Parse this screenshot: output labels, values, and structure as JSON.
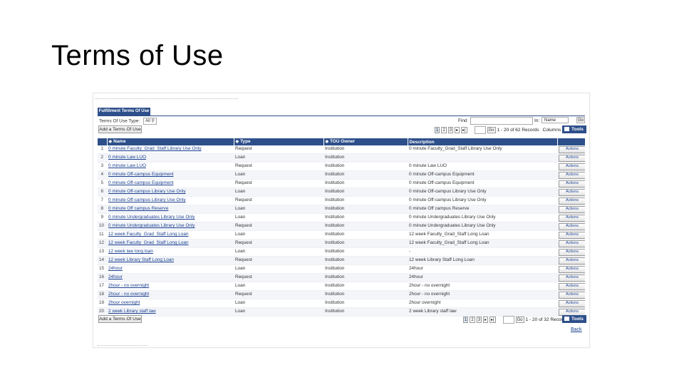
{
  "slide_title": "Terms of Use",
  "page_tab": "Fulfillment Terms Of Use",
  "filter": {
    "label": "Terms Of Use Type:",
    "value": "All"
  },
  "search": {
    "find_label": "Find",
    "find_value": "",
    "in_label": "In:",
    "in_value": "Name",
    "go_label": "Go"
  },
  "toolbar": {
    "add_label": "Add a Terms Of Use",
    "tools_label": "Tools",
    "columns_label": "Columns"
  },
  "pager": {
    "pages": [
      "1",
      "2",
      "3"
    ],
    "next": "▸",
    "last": "▸|",
    "go_label": "Go",
    "records": "1 - 20 of 62 Records",
    "records_bottom": "1 - 20 of 32 Records"
  },
  "columns": [
    "",
    "Name",
    "Type",
    "TOU Owner",
    "Description",
    ""
  ],
  "action_label": "Actions",
  "rows": [
    {
      "n": "1",
      "name": "0 minute Faculty_Grad_Staff Library Use Only",
      "type": "Request",
      "owner": "Institution",
      "desc": "0 minute Faculty_Grad_Staff Library Use Only"
    },
    {
      "n": "2",
      "name": "0 minute Law LUO",
      "type": "Loan",
      "owner": "Institution",
      "desc": ""
    },
    {
      "n": "3",
      "name": "0 minute Law LUO",
      "type": "Request",
      "owner": "Institution",
      "desc": "0 minute Law LUO"
    },
    {
      "n": "4",
      "name": "0 minute Off-campus Equipment",
      "type": "Loan",
      "owner": "Institution",
      "desc": "0 minute Off-campus Equipment"
    },
    {
      "n": "5",
      "name": "0 minute Off-campus Equipment",
      "type": "Request",
      "owner": "Institution",
      "desc": "0 minute Off-campus Equipment"
    },
    {
      "n": "6",
      "name": "0 minute Off-campus Library Use Only",
      "type": "Loan",
      "owner": "Institution",
      "desc": "0 minute Off-campus Library Use Only"
    },
    {
      "n": "7",
      "name": "0 minute Off-campus Library Use Only",
      "type": "Request",
      "owner": "Institution",
      "desc": "0 minute Off-campus Library Use Only"
    },
    {
      "n": "8",
      "name": "0 minute Off campus Reserve",
      "type": "Loan",
      "owner": "Institution",
      "desc": "0 minute Off campus Reserve"
    },
    {
      "n": "9",
      "name": "0 minute Undergraduates Library Use Only",
      "type": "Loan",
      "owner": "Institution",
      "desc": "0 minute Undergraduates Library Use Only"
    },
    {
      "n": "10",
      "name": "0 minute Undergraduates Library Use Only",
      "type": "Request",
      "owner": "Institution",
      "desc": "0 minute Undergraduates Library Use Only"
    },
    {
      "n": "11",
      "name": "12 week Faculty_Grad_Staff Long Loan",
      "type": "Loan",
      "owner": "Institution",
      "desc": "12 week Faculty_Grad_Staff Long Loan"
    },
    {
      "n": "12",
      "name": "12 week Faculty_Grad_Staff Long Loan",
      "type": "Request",
      "owner": "Institution",
      "desc": "12 week Faculty_Grad_Staff Long Loan"
    },
    {
      "n": "13",
      "name": "12 week law long loan",
      "type": "Loan",
      "owner": "Institution",
      "desc": "-"
    },
    {
      "n": "14",
      "name": "12 week Library Staff Long Loan",
      "type": "Request",
      "owner": "Institution",
      "desc": "12 week Library Staff Long Loan"
    },
    {
      "n": "15",
      "name": "24hour",
      "type": "Loan",
      "owner": "Institution",
      "desc": "24hour"
    },
    {
      "n": "16",
      "name": "24hour",
      "type": "Request",
      "owner": "Institution",
      "desc": "24hour"
    },
    {
      "n": "17",
      "name": "2hour - no overnight",
      "type": "Loan",
      "owner": "Institution",
      "desc": "2hour - no overnight"
    },
    {
      "n": "18",
      "name": "2hour - no overnight",
      "type": "Request",
      "owner": "Institution",
      "desc": "2hour - no overnight"
    },
    {
      "n": "19",
      "name": "2hour overnight",
      "type": "Loan",
      "owner": "Institution",
      "desc": "2hour overnight"
    },
    {
      "n": "20",
      "name": "2 week Library staff law",
      "type": "Loan",
      "owner": "Institution",
      "desc": "2 week Library staff law"
    }
  ],
  "back_label": "Back",
  "colors": {
    "header_blue": "#2d4f8a",
    "link_blue": "#1a3f8f"
  }
}
